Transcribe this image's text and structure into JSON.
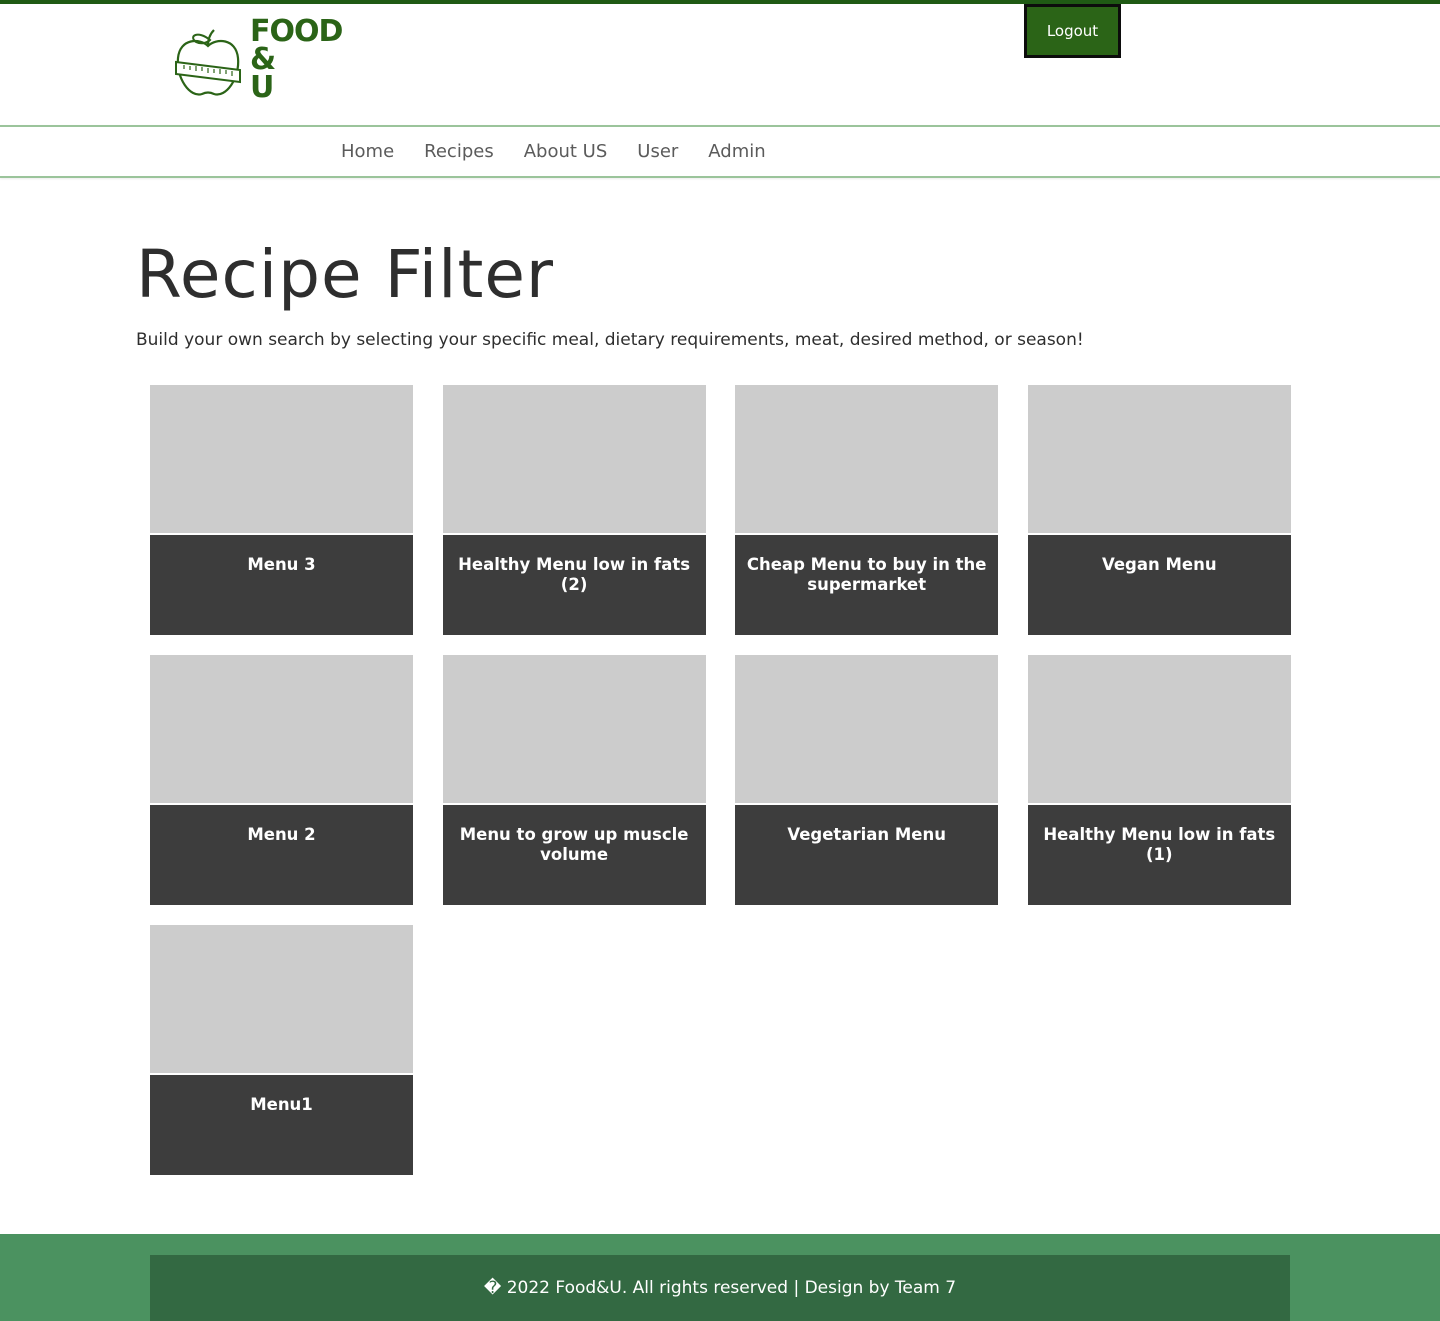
{
  "logo": {
    "line1": "FOOD",
    "line2": "&",
    "line3": "U"
  },
  "header": {
    "logout_label": "Logout"
  },
  "nav": {
    "items": [
      "Home",
      "Recipes",
      "About US",
      "User",
      "Admin"
    ]
  },
  "page": {
    "title": "Recipe Filter",
    "subtitle": "Build your own search by selecting your specific meal, dietary requirements, meat, desired method, or season!"
  },
  "menus": [
    "Menu 3",
    "Healthy Menu low in fats (2)",
    "Cheap Menu to buy in the supermarket",
    "Vegan Menu",
    "Menu 2",
    "Menu to grow up muscle volume",
    "Vegetarian Menu",
    "Healthy Menu low in fats (1)",
    "Menu1"
  ],
  "footer": {
    "text": "� 2022 Food&U. All rights reserved | Design by Team 7"
  },
  "colors": {
    "brand_green": "#2b6417",
    "card_dark": "#3d3d3d",
    "card_image": "#cccccc",
    "footer_outer": "#4b9260",
    "footer_inner": "#336942"
  }
}
